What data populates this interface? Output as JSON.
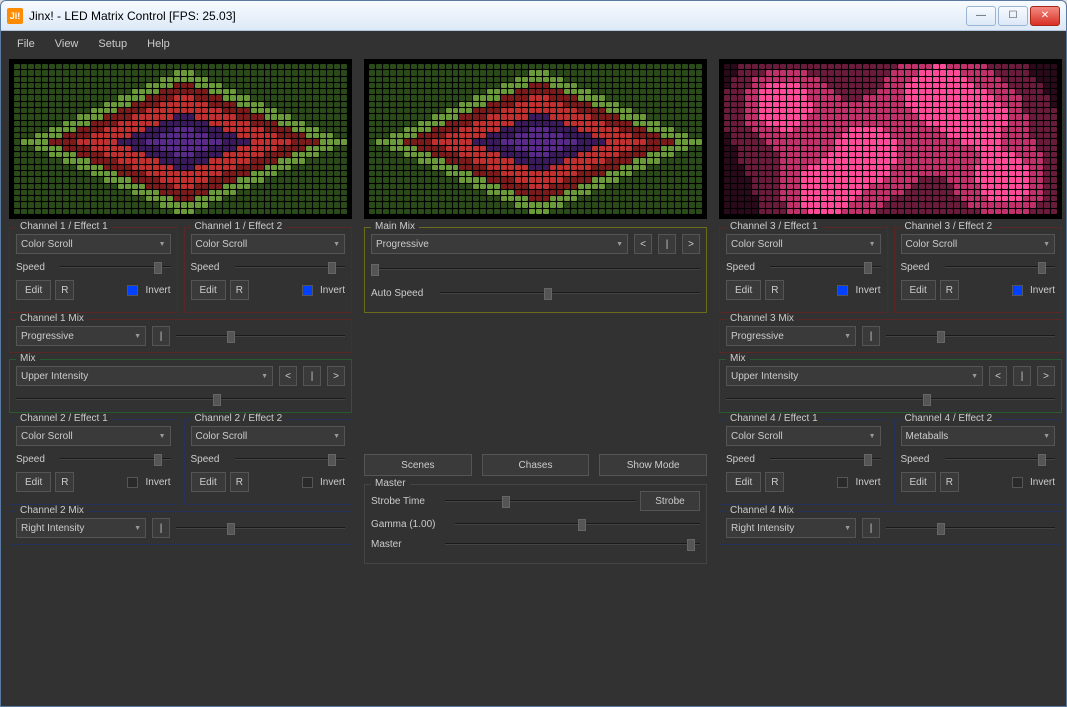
{
  "window": {
    "title": "Jinx! - LED Matrix Control [FPS: 25.03]",
    "icon_text": "Ji!"
  },
  "menu": {
    "file": "File",
    "view": "View",
    "setup": "Setup",
    "help": "Help"
  },
  "effects": {
    "ch1e1": {
      "title": "Channel 1 / Effect 1",
      "sel": "Color Scroll",
      "speed": "Speed",
      "edit": "Edit",
      "r": "R",
      "invert": "Invert",
      "invert_checked": true
    },
    "ch1e2": {
      "title": "Channel 1 / Effect 2",
      "sel": "Color Scroll",
      "speed": "Speed",
      "edit": "Edit",
      "r": "R",
      "invert": "Invert",
      "invert_checked": true
    },
    "ch2e1": {
      "title": "Channel 2 / Effect 1",
      "sel": "Color Scroll",
      "speed": "Speed",
      "edit": "Edit",
      "r": "R",
      "invert": "Invert",
      "invert_checked": false
    },
    "ch2e2": {
      "title": "Channel 2 / Effect 2",
      "sel": "Color Scroll",
      "speed": "Speed",
      "edit": "Edit",
      "r": "R",
      "invert": "Invert",
      "invert_checked": false
    },
    "ch3e1": {
      "title": "Channel 3 / Effect 1",
      "sel": "Color Scroll",
      "speed": "Speed",
      "edit": "Edit",
      "r": "R",
      "invert": "Invert",
      "invert_checked": true
    },
    "ch3e2": {
      "title": "Channel 3 / Effect 2",
      "sel": "Color Scroll",
      "speed": "Speed",
      "edit": "Edit",
      "r": "R",
      "invert": "Invert",
      "invert_checked": true
    },
    "ch4e1": {
      "title": "Channel 4 / Effect 1",
      "sel": "Color Scroll",
      "speed": "Speed",
      "edit": "Edit",
      "r": "R",
      "invert": "Invert",
      "invert_checked": false
    },
    "ch4e2": {
      "title": "Channel 4 / Effect 2",
      "sel": "Metaballs",
      "speed": "Speed",
      "edit": "Edit",
      "r": "R",
      "invert": "Invert",
      "invert_checked": false
    }
  },
  "chmix": {
    "ch1": {
      "title": "Channel 1 Mix",
      "sel": "Progressive"
    },
    "ch2": {
      "title": "Channel 2 Mix",
      "sel": "Right Intensity"
    },
    "ch3": {
      "title": "Channel 3 Mix",
      "sel": "Progressive"
    },
    "ch4": {
      "title": "Channel 4 Mix",
      "sel": "Right Intensity"
    }
  },
  "mix": {
    "left": {
      "title": "Mix",
      "sel": "Upper Intensity"
    },
    "right": {
      "title": "Mix",
      "sel": "Upper Intensity"
    }
  },
  "mainmix": {
    "title": "Main Mix",
    "sel": "Progressive",
    "auto": "Auto Speed"
  },
  "buttons": {
    "scenes": "Scenes",
    "chases": "Chases",
    "showmode": "Show Mode"
  },
  "master": {
    "title": "Master",
    "strobe_time": "Strobe Time",
    "strobe": "Strobe",
    "gamma": "Gamma (1.00)",
    "master": "Master"
  },
  "nav": {
    "prev": "<",
    "pipe": "|",
    "next": ">"
  }
}
